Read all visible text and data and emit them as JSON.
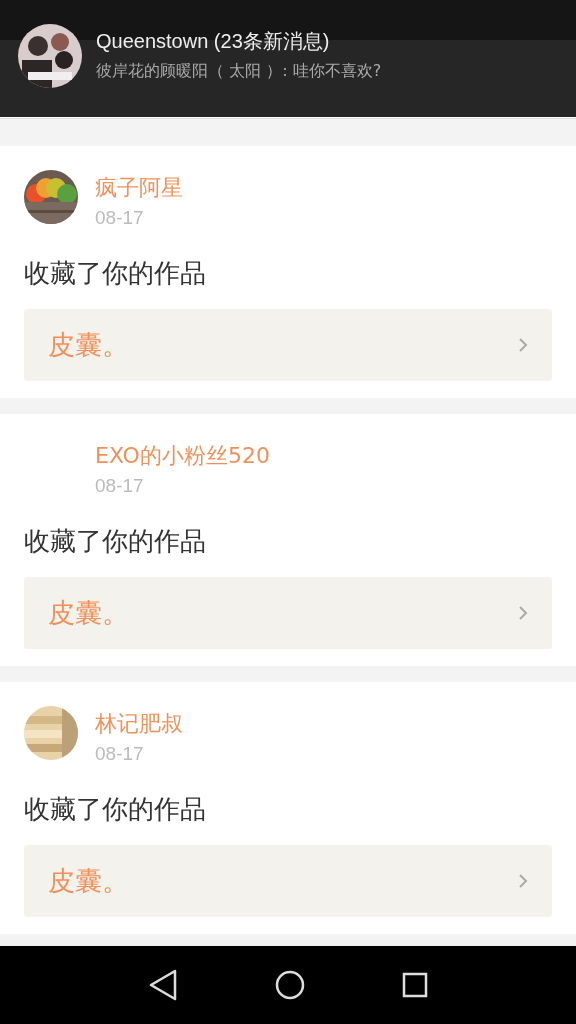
{
  "notification": {
    "title": "Queenstown (23条新消息)",
    "text": "彼岸花的顾暖阳（ 太阳 ）: 哇你不喜欢?"
  },
  "messages": [
    {
      "user": "疯子阿星",
      "avatar": true,
      "date": "08-17",
      "action": "收藏了你的作品",
      "work": "皮囊。"
    },
    {
      "user": "EXO的小粉丝520",
      "avatar": false,
      "date": "08-17",
      "action": "收藏了你的作品",
      "work": "皮囊。"
    },
    {
      "user": "林记肥叔",
      "avatar": true,
      "date": "08-17",
      "action": "收藏了你的作品",
      "work": "皮囊。"
    }
  ]
}
